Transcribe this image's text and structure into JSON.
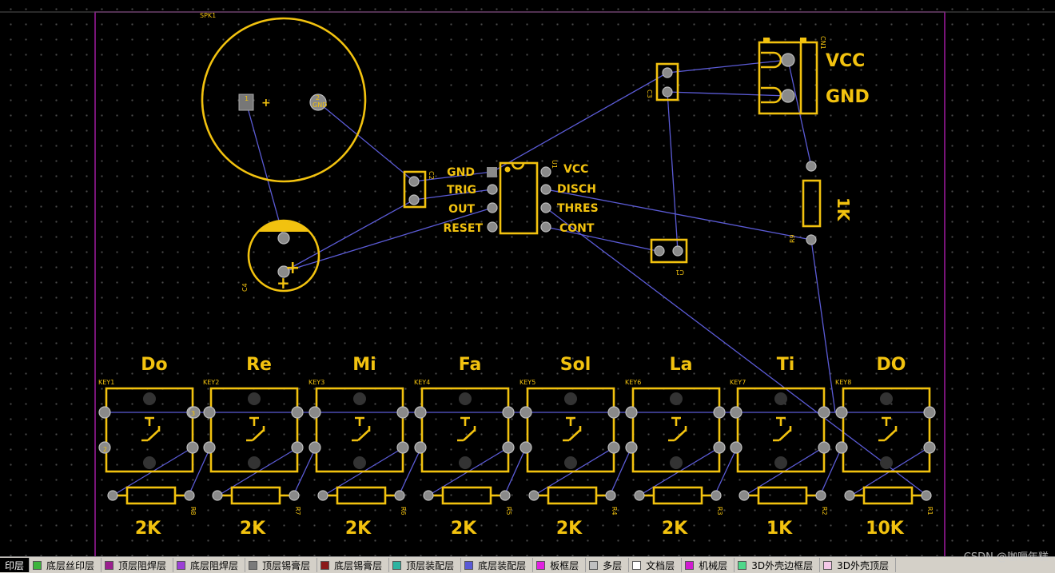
{
  "pcb": {
    "ic": {
      "ref": "U1",
      "left_pins": [
        "GND",
        "TRIG",
        "OUT",
        "RESET"
      ],
      "right_pins": [
        "VCC",
        "DISCH",
        "THRES",
        "CONT"
      ]
    },
    "speaker": {
      "ref": "SPK1",
      "plus": "+",
      "pin1": "1",
      "pin2": "2",
      "pin2_net": "GND"
    },
    "cap4": {
      "ref": "C4",
      "plus": "+"
    },
    "cap2": {
      "ref": "C2"
    },
    "cap3": {
      "ref": "C3"
    },
    "cap1": {
      "ref": "C1"
    },
    "connector": {
      "ref": "CN1",
      "labels": [
        "VCC",
        "GND"
      ]
    },
    "r9": {
      "ref": "R9",
      "value": "1K"
    },
    "pad_numbers": [
      "3",
      "2"
    ],
    "keys": [
      {
        "note": "Do",
        "ref": "KEY1",
        "res_ref": "R8",
        "value": "2K"
      },
      {
        "note": "Re",
        "ref": "KEY2",
        "res_ref": "R7",
        "value": "2K"
      },
      {
        "note": "Mi",
        "ref": "KEY3",
        "res_ref": "R6",
        "value": "2K"
      },
      {
        "note": "Fa",
        "ref": "KEY4",
        "res_ref": "R5",
        "value": "2K"
      },
      {
        "note": "Sol",
        "ref": "KEY5",
        "res_ref": "R4",
        "value": "2K"
      },
      {
        "note": "La",
        "ref": "KEY6",
        "res_ref": "R3",
        "value": "2K"
      },
      {
        "note": "Ti",
        "ref": "KEY7",
        "res_ref": "R2",
        "value": "1K"
      },
      {
        "note": "DO",
        "ref": "KEY8",
        "res_ref": "R1",
        "value": "10K"
      }
    ]
  },
  "layers": [
    {
      "label": "印层",
      "color": "#000000",
      "active": true
    },
    {
      "label": "底层丝印层",
      "color": "#3cb43c"
    },
    {
      "label": "顶层阻焊层",
      "color": "#9b1f8f"
    },
    {
      "label": "底层阻焊层",
      "color": "#9b3fd6"
    },
    {
      "label": "顶层锡膏层",
      "color": "#7a7a7a"
    },
    {
      "label": "底层锡膏层",
      "color": "#8b1a1a"
    },
    {
      "label": "顶层装配层",
      "color": "#2cb3a0"
    },
    {
      "label": "底层装配层",
      "color": "#5a5ad6"
    },
    {
      "label": "板框层",
      "color": "#e020e0"
    },
    {
      "label": "多层",
      "color": "#c0c0c0"
    },
    {
      "label": "文档层",
      "color": "#ffffff"
    },
    {
      "label": "机械层",
      "color": "#d01ad0"
    },
    {
      "label": "3D外壳边框层",
      "color": "#4ed88a"
    },
    {
      "label": "3D外壳顶层",
      "color": "#f4c8e8"
    }
  ],
  "watermark": "CSDN @咖喱年糕"
}
